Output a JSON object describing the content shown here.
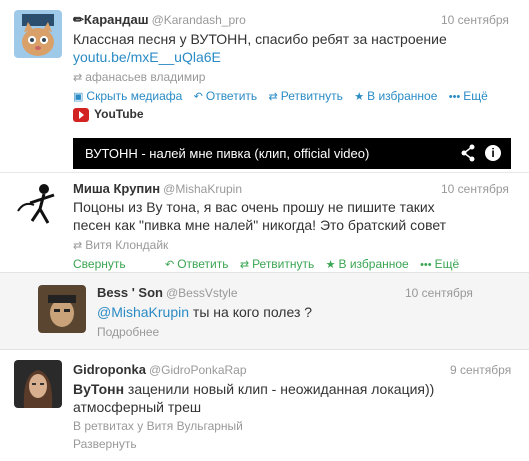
{
  "tweets": [
    {
      "name": "✏Карандаш",
      "handle": "@Karandash_pro",
      "time": "10 сентября",
      "text": "Классная песня у ВУТОНН, спасибо ребят за настроение",
      "link": "youtu.be/mxE__uQla6E",
      "retweeted_by": "афанасьев владимир",
      "actions": {
        "hide_media": "Скрыть медиафа",
        "reply": "Ответить",
        "retweet": "Ретвитнуть",
        "favorite": "В избранное",
        "more": "Ещё"
      },
      "media_source": "YouTube",
      "video_title": "ВУТОНН - налей мне пивка (клип, official video)"
    },
    {
      "name": "Миша Крупин",
      "handle": "@MishaKrupin",
      "time": "10 сентября",
      "text_line1": "Поцоны из Ву тона, я вас очень прошу не пишите таких",
      "text_line2": "песен как \"пивка мне налей\" никогда! Это братский совет",
      "retweeted_by": "Витя Клондайк",
      "actions": {
        "collapse": "Свернуть",
        "reply": "Ответить",
        "retweet": "Ретвитнуть",
        "favorite": "В избранное",
        "more": "Ещё"
      }
    },
    {
      "name": "Bess ' Son",
      "handle": "@BessVstyle",
      "time": "10 сентября",
      "mention": "@MishaKrupin",
      "text": " ты на кого полез ?",
      "details": "Подробнее"
    },
    {
      "name": "Gidroponka",
      "handle": "@GidroPonkaRap",
      "time": "9 сентября",
      "text_bold": "ВуТонн",
      "text_line1": " заценили новый клип - неожиданная локация))",
      "text_line2": "атмосферный треш",
      "retweeted_by": "В ретвитах у Витя Вульгарный",
      "expand": "Развернуть"
    }
  ],
  "colors": {
    "link": "#2a8bc5",
    "green": "#3aa552",
    "muted": "#999999"
  }
}
